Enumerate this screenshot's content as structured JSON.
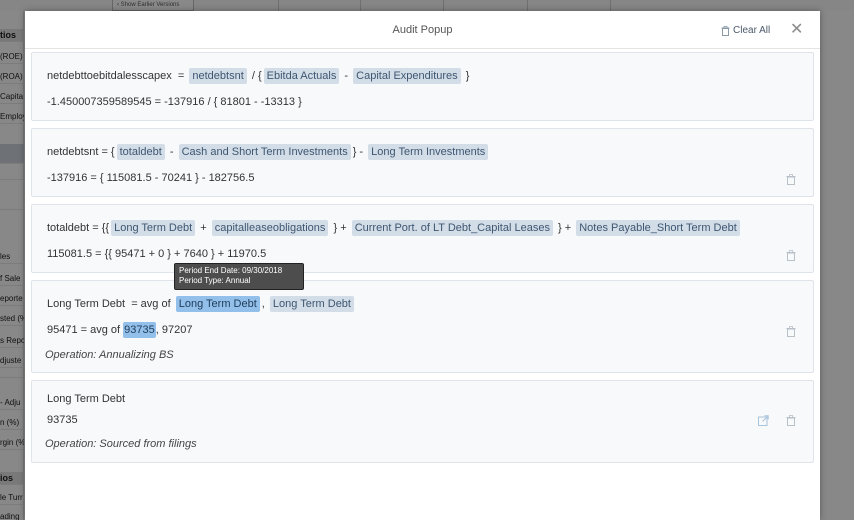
{
  "background": {
    "show_earlier_label": "Show Earlier Versions",
    "sidebar_rows": [
      "tios",
      "(ROE)",
      "(ROA)",
      "Capita",
      "Employ",
      "",
      "",
      "",
      "les",
      "f Sale",
      "eporte",
      "sted (%",
      "s Repo",
      "djuste",
      "",
      "- Adju",
      "n (%)",
      "rgin (%",
      "ios",
      "le Turr",
      "ading"
    ]
  },
  "modal": {
    "title": "Audit Popup",
    "clear_all_label": "Clear All",
    "close_symbol": "✕"
  },
  "cards": [
    {
      "formula": {
        "lhs": "netdebttoebitdalesscapex",
        "eq": "=",
        "t1": "netdebtsnt",
        "t2": "/ {",
        "t3": "Ebitda Actuals",
        "t4": "-",
        "t5": "Capital Expenditures",
        "t6": "}"
      },
      "values": "-1.450007359589545  =  -137916  / { 81801  -  -13313 }"
    },
    {
      "formula": {
        "lhs": "netdebtsnt",
        "eq": "= {",
        "t1": "totaldebt",
        "t2": "-",
        "t3": "Cash and Short Term Investments",
        "t4": "} -",
        "t5": "Long Term Investments"
      },
      "values": "-137916  = { 115081.5  -  70241 } -  182756.5"
    },
    {
      "formula": {
        "lhs": "totaldebt",
        "eq": "= {{",
        "t1": "Long Term Debt",
        "t2": "+",
        "t3": "capitalleaseobligations",
        "t4": "} +",
        "t5": "Current Port. of LT Debt_Capital Leases",
        "t6": "} +",
        "t7": "Notes Payable_Short Term Debt"
      },
      "values": "115081.5  = {{ 95471  +  0 } +  7640 } +  11970.5"
    },
    {
      "formula": {
        "lhs": "Long Term Debt",
        "eq": "= avg of",
        "t1": "Long Term Debt",
        "t2": ",",
        "t3": "Long Term Debt"
      },
      "values": {
        "prefix": "95471  = avg of",
        "v1": "93735",
        "sep": ",",
        "v2": "97207"
      },
      "operation": "Operation: Annualizing BS"
    },
    {
      "title": "Long Term Debt",
      "value": "93735",
      "operation": "Operation: Sourced from filings"
    }
  ],
  "tooltip": {
    "line1": "Period End Date: 09/30/2018",
    "line2": "Period Type: Annual"
  },
  "colors": {
    "chip_bg": "#d3dde8",
    "chip_active_bg": "#93c0ea",
    "card_bg": "#f7f9fb"
  }
}
